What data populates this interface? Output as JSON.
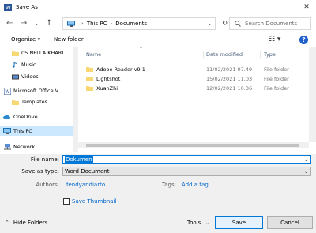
{
  "window": {
    "title": "Save As",
    "close_glyph": "✕"
  },
  "nav": {
    "back_glyph": "←",
    "forward_glyph": "→",
    "history_glyph": "⌄",
    "up_glyph": "↑",
    "breadcrumb": [
      "This PC",
      "Documents"
    ],
    "breadcrumb_sep": "›",
    "refresh_glyph": "↻",
    "search_placeholder": "Search Documents"
  },
  "toolbar": {
    "organize": "Organize ▾",
    "new_folder": "New folder",
    "view_glyph": "☷ ▾",
    "help_glyph": "?"
  },
  "sidebar": {
    "items": [
      {
        "label": "05 NELLA KHARI",
        "icon": "folder-icon"
      },
      {
        "label": "Music",
        "icon": "music-icon"
      },
      {
        "label": "Videos",
        "icon": "videos-icon"
      },
      {
        "label": "Microsoft Office V",
        "icon": "word-icon"
      },
      {
        "label": "Templates",
        "icon": "folder-icon"
      },
      {
        "label": "OneDrive",
        "icon": "cloud-icon"
      },
      {
        "label": "This PC",
        "icon": "pc-icon"
      },
      {
        "label": "Network",
        "icon": "network-icon"
      }
    ]
  },
  "files": {
    "columns": {
      "name": "Name",
      "date": "Date modified",
      "type": "Type"
    },
    "sort_glyph": "⌃",
    "rows": [
      {
        "name": "Adobe Reader v9.1",
        "date": "11/02/2021 07.49",
        "type": "File folder"
      },
      {
        "name": "Lightshot",
        "date": "15/02/2021 11.03",
        "type": "File folder"
      },
      {
        "name": "XuanZhi",
        "date": "12/02/2021 10.36",
        "type": "File folder"
      }
    ]
  },
  "form": {
    "filename_label": "File name:",
    "filename_value": "Dokumen",
    "savetype_label": "Save as type:",
    "savetype_value": "Word Document",
    "authors_label": "Authors:",
    "authors_value": "fendyandiarto",
    "tags_label": "Tags:",
    "tags_value": "Add a tag",
    "thumbnail_label": "Save Thumbnail",
    "dropdown_glyph": "⌄"
  },
  "footer": {
    "hide_folders": "Hide Folders",
    "tools": "Tools",
    "save": "Save",
    "cancel": "Cancel"
  },
  "colors": {
    "accent": "#0078d7",
    "link": "#0066cc",
    "selection": "#cce8ff",
    "folder": "#f8d775"
  }
}
